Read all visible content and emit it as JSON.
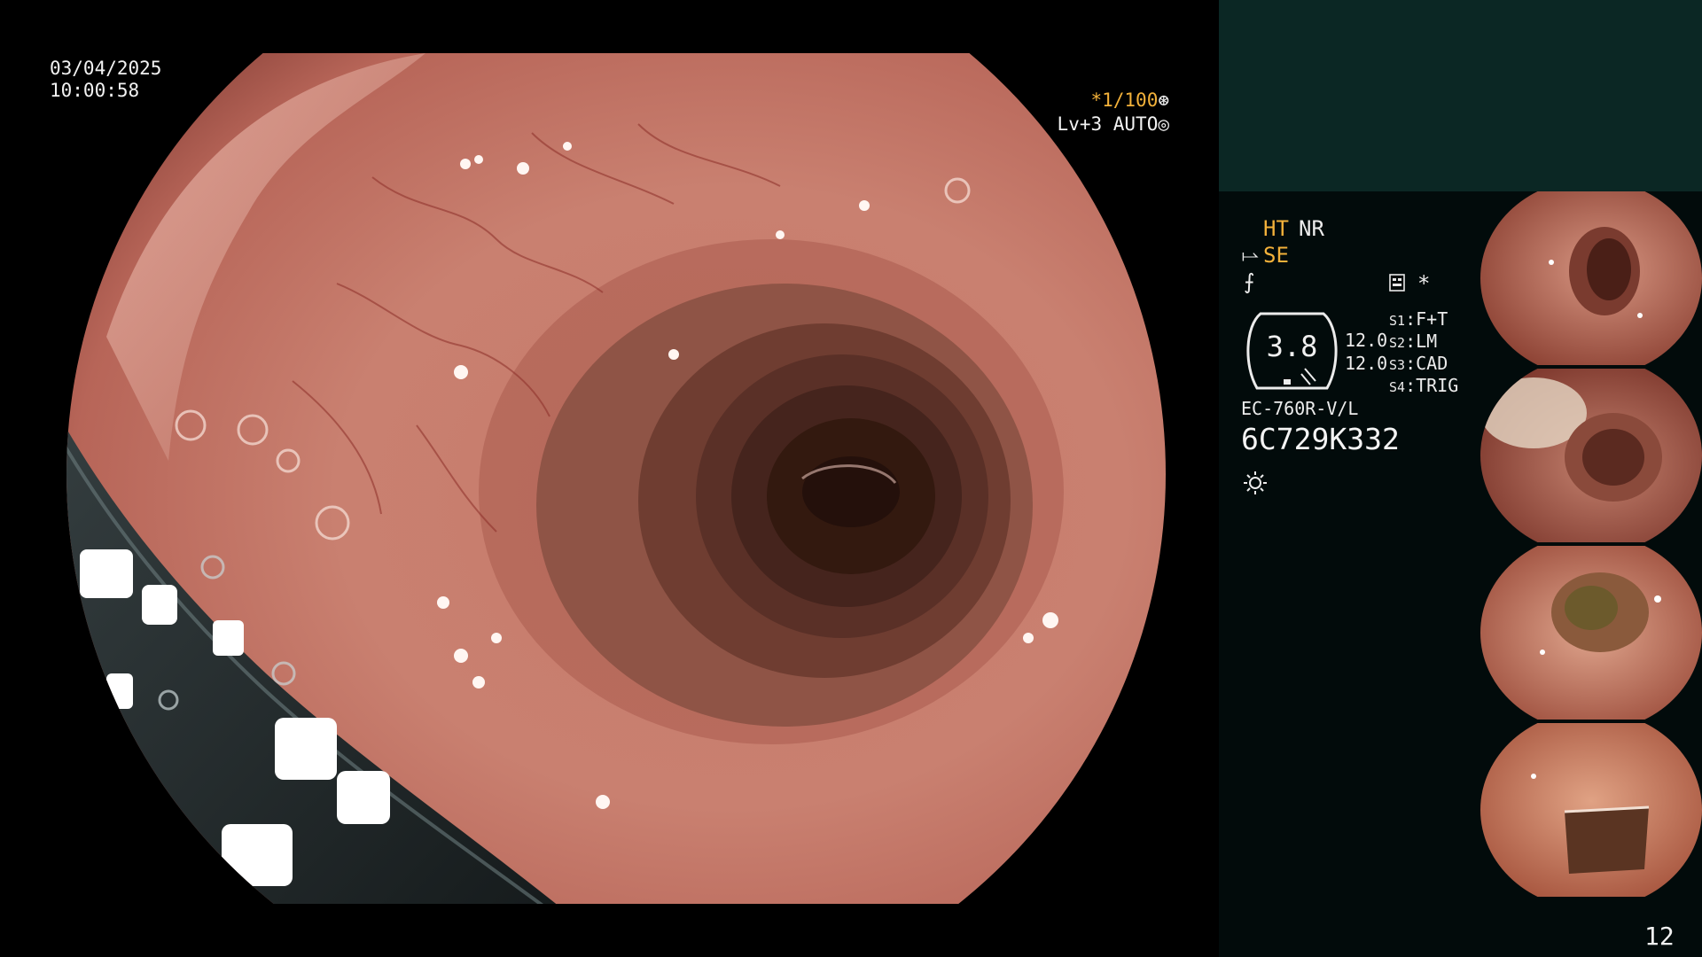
{
  "live_view": {
    "date": "03/04/2025",
    "time": "10:00:58",
    "shutter": "*1/100",
    "shutter_icon": "aperture-icon",
    "level": "Lv+3 AUTO",
    "level_icon": "auto-iris-icon"
  },
  "panel": {
    "mode_ht": "HT",
    "mode_nr": "NR",
    "se_icon": "structure-enhance-icon",
    "mode_se": "SE",
    "f_icon": "color-mode-icon",
    "settings_icon": "settings-list-icon",
    "asterisk": "*",
    "gauge_value": "3.8",
    "gauge_side_1": "12.0",
    "gauge_side_2": "12.0",
    "switches": [
      {
        "key": "S1",
        "value": "F+T"
      },
      {
        "key": "S2",
        "value": "LM"
      },
      {
        "key": "S3",
        "value": "CAD"
      },
      {
        "key": "S4",
        "value": "TRIG"
      }
    ],
    "scope_model": "EC-760R-V/L",
    "scope_serial": "6C729K332",
    "light_icon": "light-source-icon",
    "page_number": "12"
  },
  "thumbnails": [
    {
      "name": "capture-1"
    },
    {
      "name": "capture-2"
    },
    {
      "name": "capture-3"
    },
    {
      "name": "capture-4"
    }
  ],
  "colors": {
    "accent_orange": "#f3b13a",
    "panel_band": "#0b2724",
    "panel_bg": "#020b0b",
    "text": "#ececec"
  }
}
